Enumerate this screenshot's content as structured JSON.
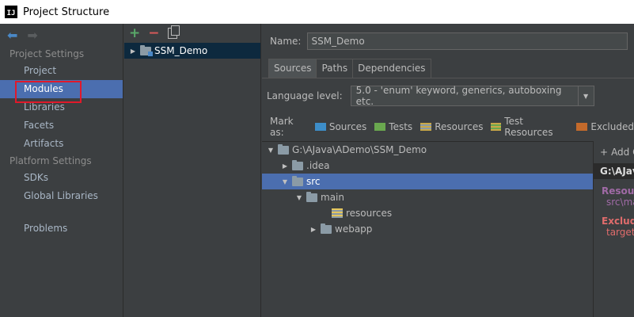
{
  "window": {
    "title": "Project Structure",
    "app_icon_text": "IJ"
  },
  "nav": {
    "project_settings_header": "Project Settings",
    "project_settings_items": [
      "Project",
      "Modules",
      "Libraries",
      "Facets",
      "Artifacts"
    ],
    "platform_settings_header": "Platform Settings",
    "platform_settings_items": [
      "SDKs",
      "Global Libraries"
    ],
    "problems": "Problems",
    "selected": "Modules"
  },
  "modules": {
    "items": [
      {
        "name": "SSM_Demo",
        "selected": true
      }
    ]
  },
  "content": {
    "name_label": "Name:",
    "name_value": "SSM_Demo",
    "tabs": [
      "Sources",
      "Paths",
      "Dependencies"
    ],
    "active_tab": "Sources",
    "language_label": "Language level:",
    "language_value": "5.0 - 'enum' keyword, generics, autoboxing etc.",
    "mark_as_label": "Mark as:",
    "mark_buttons": [
      {
        "label": "Sources",
        "color": "#3d8ec9"
      },
      {
        "label": "Tests",
        "color": "#6aa84f"
      },
      {
        "label": "Resources",
        "color": "#c9a848"
      },
      {
        "label": "Test Resources",
        "color": "#c9a848"
      },
      {
        "label": "Excluded",
        "color": "#c46a2b"
      }
    ]
  },
  "tree": {
    "root": "G:\\AJava\\ADemo\\SSM_Demo",
    "idea": ".idea",
    "src": "src",
    "main": "main",
    "resources": "resources",
    "webapp": "webapp"
  },
  "side_panel": {
    "add": "Add C",
    "path": "G:\\AJav",
    "resource_header": "Resource",
    "resource_path": "src\\ma",
    "excluded_header": "Exclude",
    "excluded_path": "target"
  }
}
